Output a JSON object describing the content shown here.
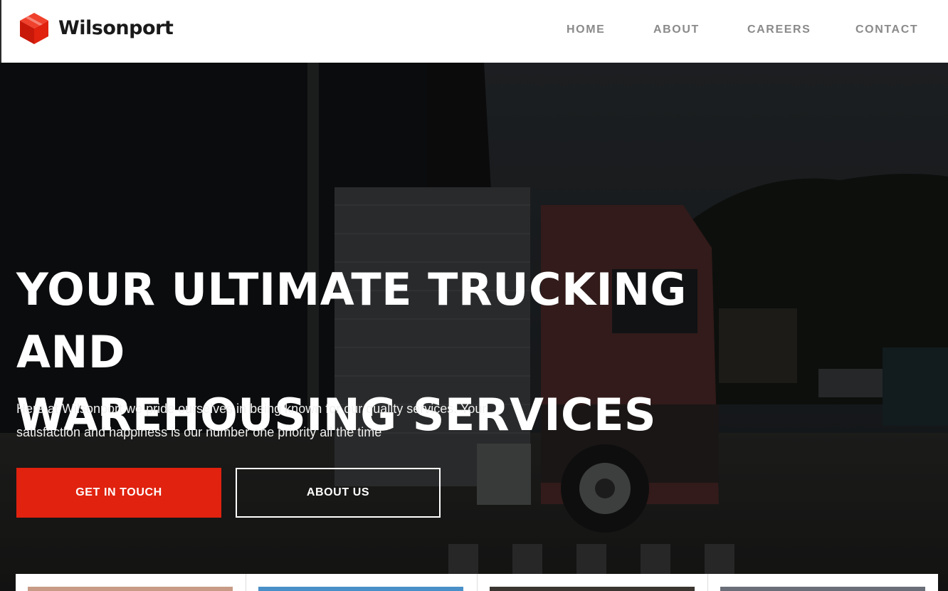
{
  "brand": {
    "name": "Wilsonport",
    "logo_icon": "red-cube-icon",
    "logo_color": "#e0220f"
  },
  "nav": {
    "items": [
      {
        "label": "HOME"
      },
      {
        "label": "ABOUT"
      },
      {
        "label": "CAREERS"
      },
      {
        "label": "CONTACT"
      }
    ]
  },
  "hero": {
    "title_line1": "YOUR ULTIMATE TRUCKING AND",
    "title_line2": "WAREHOUSING SERVICES",
    "text_line1": "Here at Wilsonport we pride ourselves in being known for our quality services. Your",
    "text_line2": "satisfaction and happiness is our number one priority all the time",
    "primary_button": "GET IN TOUCH",
    "secondary_button": "ABOUT US",
    "accent_color": "#e0220f"
  },
  "cards": [
    {
      "thumb_color": "#c79b86"
    },
    {
      "thumb_color": "#4a90c8"
    },
    {
      "thumb_color": "#3a3530"
    },
    {
      "thumb_color": "#6a6e78"
    }
  ]
}
